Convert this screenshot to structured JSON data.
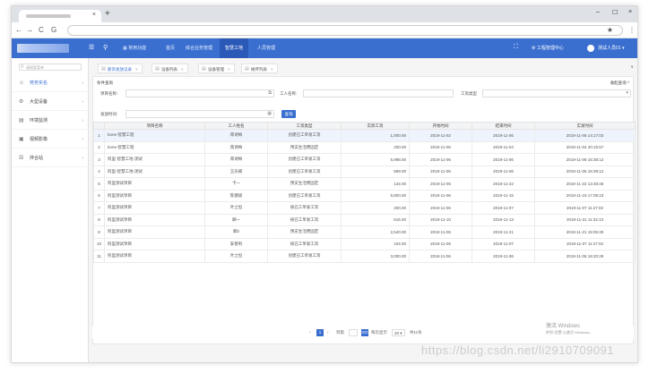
{
  "browser": {
    "new_tab": "+",
    "close_tab": "×",
    "win_min": "–",
    "win_max": "☐",
    "win_close": "×",
    "back": "←",
    "forward": "→",
    "reload": "C",
    "info": "G",
    "star": "★",
    "menu": "⋮"
  },
  "header": {
    "nav": [
      "常用功能",
      "首页",
      "综合业务管理",
      "智慧工地",
      "人员管理"
    ],
    "active_nav": "智慧工地",
    "project_center": "工程管理中心",
    "user": "测试人员01"
  },
  "sidebar": {
    "search_placeholder": "请搜索菜单",
    "items": [
      {
        "label": "劳务实名",
        "icon": "user-icon",
        "active": true
      },
      {
        "label": "大型设备",
        "icon": "machine-icon"
      },
      {
        "label": "环境监测",
        "icon": "environment-icon"
      },
      {
        "label": "视频影像",
        "icon": "video-icon"
      },
      {
        "label": "拌合站",
        "icon": "mixing-icon"
      }
    ]
  },
  "content_tabs": [
    {
      "label": "薪资发放记录",
      "active": true
    },
    {
      "label": "设备列表"
    },
    {
      "label": "设备管理"
    },
    {
      "label": "摊传列表"
    }
  ],
  "filter": {
    "title": "条件查询",
    "collapse": "收起查询",
    "project_label": "项目名称:",
    "worker_label": "工人名称:",
    "type_label": "工资类型",
    "time_label": "发放时间:",
    "query_button": "查询"
  },
  "table": {
    "columns": [
      "项目名称",
      "工人姓名",
      "工资类型",
      "实际工资",
      "开始时间",
      "结束时间",
      "实发时间"
    ],
    "rows": [
      {
        "no": "1",
        "project": "bone-智慧工程",
        "worker": "蒋诗梅",
        "type": "创建已工单发工资",
        "salary": "1,000.00",
        "start": "2019-11-02",
        "end": "2019-11-06",
        "paid": "2019-11-06 14:17:03"
      },
      {
        "no": "2",
        "project": "bone-智慧工程",
        "worker": "蒋诗梅",
        "type": "预支生活费固定",
        "salary": "200.00",
        "start": "2019-11-06",
        "end": "2019-11-04",
        "paid": "2019-11-04 20:15:57"
      },
      {
        "no": "3",
        "project": "阿里-智慧工地-测试",
        "worker": "蒋诗梅",
        "type": "创建已工单发工资",
        "salary": "5,998.00",
        "start": "2019-11-06",
        "end": "2019-11-06",
        "paid": "2019-11-06 15:38:12"
      },
      {
        "no": "4",
        "project": "阿里-智慧工地-测试",
        "worker": "王乐楠",
        "type": "创建已工单发工资",
        "salary": "699.00",
        "start": "2019-11-06",
        "end": "2019-11-06",
        "paid": "2019-11-06 15:38:12"
      },
      {
        "no": "5",
        "project": "阿里测试项目",
        "worker": "卡一",
        "type": "预支生活费固定",
        "salary": "134.00",
        "start": "2019-11-05",
        "end": "2019-11-22",
        "paid": "2019-11-22 13:48:46"
      },
      {
        "no": "6",
        "project": "阿里测试项目",
        "worker": "陈健级",
        "type": "创建已工单发工资",
        "salary": "5,800.00",
        "start": "2019-11-06",
        "end": "2019-11-15",
        "paid": "2019-11-15 17:08:23"
      },
      {
        "no": "7",
        "project": "阿里测试项目",
        "worker": "叶之恒",
        "type": "按已工单发工资",
        "salary": "200.00",
        "start": "2019-11-06",
        "end": "2019-11-07",
        "paid": "2019-11-07 11:27:02"
      },
      {
        "no": "8",
        "project": "阿里测试项目",
        "worker": "卿一",
        "type": "按已工单发工资",
        "salary": "615.00",
        "start": "2019-11-10",
        "end": "2019-11-13",
        "paid": "2019-11-21 11:34:13"
      },
      {
        "no": "9",
        "project": "阿里测试项目",
        "worker": "卿2",
        "type": "预支生活费固定",
        "salary": "2,540.00",
        "start": "2019-11-06",
        "end": "2019-11-21",
        "paid": "2019-11-21 15:05:30"
      },
      {
        "no": "10",
        "project": "阿里测试项目",
        "worker": "安香利",
        "type": "按已工单发工资",
        "salary": "104.00",
        "start": "2019-11-05",
        "end": "2019-11-07",
        "paid": "2019-11-07 11:27:02"
      },
      {
        "no": "11",
        "project": "阿里测试项目",
        "worker": "叶之恒",
        "type": "创建已工单发工资",
        "salary": "3,000.00",
        "start": "2019-11-06",
        "end": "2019-11-06",
        "paid": "2019-11-06 16:20:29"
      }
    ]
  },
  "pager": {
    "current": "1",
    "goto": "到第",
    "page_size_label": "每页显示",
    "page_size": "20",
    "total": "共11条"
  },
  "overlay": {
    "activate_title": "激活 Windows",
    "activate_sub": "转到\"设置\"以激活 Windows。",
    "csdn": "https://blog.csdn.net/li2910709091"
  }
}
